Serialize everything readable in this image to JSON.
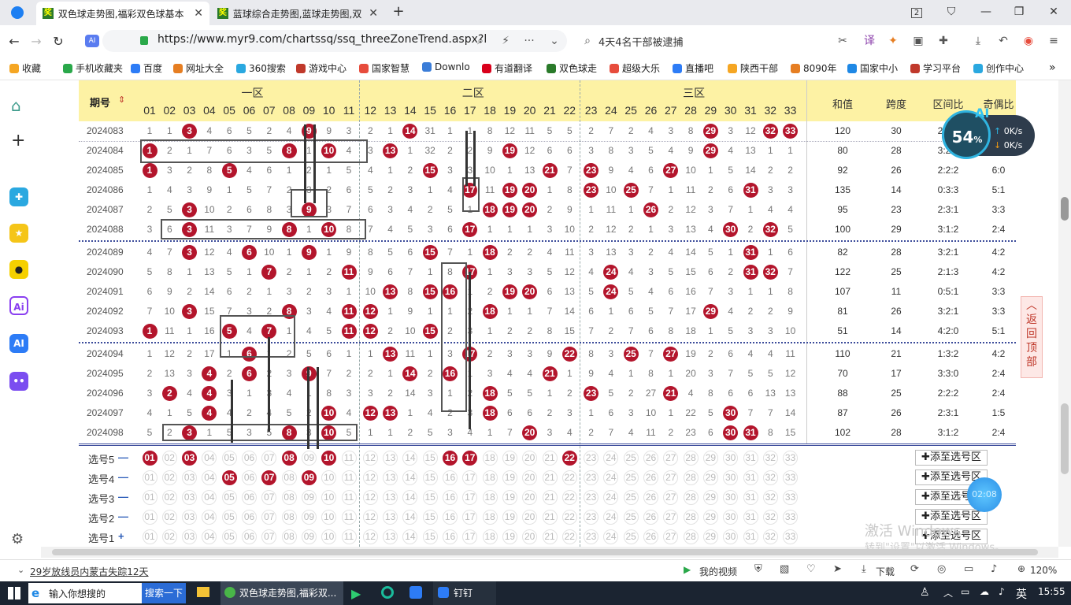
{
  "browser": {
    "tabs": [
      {
        "label": "双色球走势图,福彩双色球基本",
        "active": true
      },
      {
        "label": "蓝球综合走势图,蓝球走势图,双",
        "active": false
      }
    ],
    "url": "https://www.myr9.com/chartssq/ssq_threeZoneTrend.aspx?l",
    "search": "4天4名干部被逮捕",
    "tab_count": "2",
    "bookmarks": [
      "收藏",
      "手机收藏夹",
      "百度",
      "网址大全",
      "360搜索",
      "游戏中心",
      "国家智慧",
      "Downlo",
      "有道翻译",
      "双色球走",
      "超级大乐",
      "直播吧",
      "陕西干部",
      "8090年",
      "国家中小",
      "学习平台",
      "创作中心"
    ]
  },
  "chart": {
    "header": {
      "period": "期号",
      "zones": [
        "一区",
        "二区",
        "三区"
      ],
      "stats": [
        "和值",
        "跨度",
        "区间比",
        "奇偶比"
      ]
    },
    "numbers": [
      "01",
      "02",
      "03",
      "04",
      "05",
      "06",
      "07",
      "08",
      "09",
      "10",
      "11",
      "12",
      "13",
      "14",
      "15",
      "16",
      "17",
      "18",
      "19",
      "20",
      "21",
      "22",
      "23",
      "24",
      "25",
      "26",
      "27",
      "28",
      "29",
      "30",
      "31",
      "32",
      "33"
    ],
    "rows": [
      {
        "issue": "2024083",
        "vals": [
          1,
          1,
          3,
          4,
          6,
          5,
          2,
          4,
          9,
          9,
          3,
          2,
          1,
          14,
          31,
          1,
          1,
          8,
          12,
          11,
          5,
          5,
          2,
          7,
          2,
          4,
          3,
          8,
          29,
          3,
          12,
          32,
          33
        ],
        "hits": [
          3,
          9,
          14,
          29,
          32,
          33
        ],
        "sum": "120",
        "span": "30",
        "zone": "2:1:3",
        "oe": "3:3"
      },
      {
        "issue": "2024084",
        "vals": [
          1,
          2,
          1,
          7,
          6,
          3,
          5,
          8,
          1,
          10,
          4,
          3,
          13,
          1,
          32,
          2,
          2,
          9,
          19,
          12,
          6,
          6,
          3,
          8,
          3,
          5,
          4,
          9,
          29,
          4,
          13,
          1,
          1
        ],
        "hits": [
          1,
          8,
          10,
          13,
          19,
          29
        ],
        "sum": "80",
        "span": "28",
        "zone": "3:2:1",
        "oe": "4:2"
      },
      {
        "issue": "2024085",
        "vals": [
          1,
          3,
          2,
          8,
          5,
          4,
          6,
          1,
          2,
          1,
          5,
          4,
          1,
          2,
          15,
          3,
          3,
          10,
          1,
          13,
          21,
          7,
          23,
          9,
          4,
          6,
          27,
          10,
          1,
          5,
          14,
          2,
          2
        ],
        "hits": [
          1,
          5,
          15,
          21,
          23,
          27
        ],
        "sum": "92",
        "span": "26",
        "zone": "2:2:2",
        "oe": "6:0"
      },
      {
        "issue": "2024086",
        "vals": [
          1,
          4,
          3,
          9,
          1,
          5,
          7,
          2,
          3,
          2,
          6,
          5,
          2,
          3,
          1,
          4,
          17,
          11,
          19,
          20,
          1,
          8,
          23,
          10,
          25,
          7,
          1,
          11,
          2,
          6,
          31,
          3,
          3
        ],
        "hits": [
          17,
          19,
          20,
          23,
          25,
          31
        ],
        "sum": "135",
        "span": "14",
        "zone": "0:3:3",
        "oe": "5:1"
      },
      {
        "issue": "2024087",
        "vals": [
          2,
          5,
          3,
          10,
          2,
          6,
          8,
          3,
          9,
          3,
          7,
          6,
          3,
          4,
          2,
          5,
          1,
          18,
          19,
          20,
          2,
          9,
          1,
          11,
          1,
          26,
          2,
          12,
          3,
          7,
          1,
          4,
          4
        ],
        "hits": [
          3,
          9,
          18,
          19,
          20,
          26
        ],
        "sum": "95",
        "span": "23",
        "zone": "2:3:1",
        "oe": "3:3"
      },
      {
        "issue": "2024088",
        "vals": [
          3,
          6,
          3,
          11,
          3,
          7,
          9,
          8,
          1,
          10,
          8,
          7,
          4,
          5,
          3,
          6,
          17,
          1,
          1,
          1,
          3,
          10,
          2,
          12,
          2,
          1,
          3,
          13,
          4,
          30,
          2,
          32,
          5
        ],
        "hits": [
          3,
          8,
          10,
          17,
          30,
          32
        ],
        "sum": "100",
        "span": "29",
        "zone": "3:1:2",
        "oe": "2:4"
      },
      {
        "issue": "2024089",
        "vals": [
          4,
          7,
          3,
          12,
          4,
          6,
          10,
          1,
          9,
          1,
          9,
          8,
          5,
          6,
          15,
          7,
          1,
          18,
          2,
          2,
          4,
          11,
          3,
          13,
          3,
          2,
          4,
          14,
          5,
          1,
          31,
          1,
          6
        ],
        "hits": [
          3,
          6,
          9,
          15,
          18,
          31
        ],
        "sum": "82",
        "span": "28",
        "zone": "3:2:1",
        "oe": "4:2"
      },
      {
        "issue": "2024090",
        "vals": [
          5,
          8,
          1,
          13,
          5,
          1,
          7,
          2,
          1,
          2,
          11,
          9,
          6,
          7,
          1,
          8,
          17,
          1,
          3,
          3,
          5,
          12,
          4,
          24,
          4,
          3,
          5,
          15,
          6,
          2,
          31,
          32,
          7
        ],
        "hits": [
          7,
          11,
          17,
          24,
          31,
          32
        ],
        "sum": "122",
        "span": "25",
        "zone": "2:1:3",
        "oe": "4:2"
      },
      {
        "issue": "2024091",
        "vals": [
          6,
          9,
          2,
          14,
          6,
          2,
          1,
          3,
          2,
          3,
          1,
          10,
          13,
          8,
          15,
          16,
          1,
          2,
          19,
          20,
          6,
          13,
          5,
          24,
          5,
          4,
          6,
          16,
          7,
          3,
          1,
          1,
          8
        ],
        "hits": [
          13,
          15,
          16,
          19,
          20,
          24
        ],
        "sum": "107",
        "span": "11",
        "zone": "0:5:1",
        "oe": "3:3"
      },
      {
        "issue": "2024092",
        "vals": [
          7,
          10,
          3,
          15,
          7,
          3,
          2,
          8,
          3,
          4,
          11,
          12,
          1,
          9,
          1,
          1,
          2,
          18,
          1,
          1,
          7,
          14,
          6,
          1,
          6,
          5,
          7,
          17,
          29,
          4,
          2,
          2,
          9
        ],
        "hits": [
          3,
          8,
          11,
          12,
          18,
          29
        ],
        "sum": "81",
        "span": "26",
        "zone": "3:2:1",
        "oe": "3:3"
      },
      {
        "issue": "2024093",
        "vals": [
          1,
          11,
          1,
          16,
          5,
          4,
          7,
          1,
          4,
          5,
          11,
          12,
          2,
          10,
          15,
          2,
          3,
          1,
          2,
          2,
          8,
          15,
          7,
          2,
          7,
          6,
          8,
          18,
          1,
          5,
          3,
          3,
          10
        ],
        "hits": [
          1,
          5,
          7,
          11,
          12,
          15
        ],
        "sum": "51",
        "span": "14",
        "zone": "4:2:0",
        "oe": "5:1"
      },
      {
        "issue": "2024094",
        "vals": [
          1,
          12,
          2,
          17,
          1,
          6,
          1,
          2,
          5,
          6,
          1,
          1,
          13,
          11,
          1,
          3,
          17,
          2,
          3,
          3,
          9,
          22,
          8,
          3,
          25,
          7,
          27,
          19,
          2,
          6,
          4,
          4,
          11
        ],
        "hits": [
          6,
          13,
          17,
          22,
          25,
          27
        ],
        "sum": "110",
        "span": "21",
        "zone": "1:3:2",
        "oe": "4:2"
      },
      {
        "issue": "2024095",
        "vals": [
          2,
          13,
          3,
          4,
          2,
          6,
          2,
          3,
          9,
          7,
          2,
          2,
          1,
          14,
          2,
          16,
          1,
          3,
          4,
          4,
          21,
          1,
          9,
          4,
          1,
          8,
          1,
          20,
          3,
          7,
          5,
          5,
          12
        ],
        "hits": [
          4,
          6,
          9,
          14,
          16,
          21
        ],
        "sum": "70",
        "span": "17",
        "zone": "3:3:0",
        "oe": "2:4"
      },
      {
        "issue": "2024096",
        "vals": [
          3,
          2,
          4,
          4,
          3,
          1,
          3,
          4,
          1,
          8,
          3,
          3,
          2,
          14,
          3,
          1,
          2,
          18,
          5,
          5,
          1,
          2,
          23,
          5,
          2,
          27,
          21,
          4,
          8,
          6,
          6,
          13,
          13
        ],
        "hits": [
          2,
          4,
          18,
          23,
          27
        ],
        "sum": "88",
        "span": "25",
        "zone": "2:2:2",
        "oe": "2:4"
      },
      {
        "issue": "2024097",
        "vals": [
          4,
          1,
          5,
          4,
          4,
          2,
          4,
          5,
          2,
          10,
          4,
          12,
          13,
          1,
          4,
          2,
          3,
          18,
          6,
          6,
          2,
          3,
          1,
          6,
          3,
          10,
          1,
          22,
          5,
          30,
          7,
          7,
          14
        ],
        "hits": [
          4,
          10,
          12,
          13,
          18,
          30
        ],
        "sum": "87",
        "span": "26",
        "zone": "2:3:1",
        "oe": "1:5"
      },
      {
        "issue": "2024098",
        "vals": [
          5,
          2,
          3,
          1,
          5,
          3,
          5,
          8,
          3,
          10,
          5,
          1,
          1,
          2,
          5,
          3,
          4,
          1,
          7,
          20,
          3,
          4,
          2,
          7,
          4,
          11,
          2,
          23,
          6,
          30,
          31,
          8,
          15
        ],
        "hits": [
          3,
          8,
          10,
          20,
          30,
          31
        ],
        "sum": "102",
        "span": "28",
        "zone": "3:1:2",
        "oe": "2:4"
      }
    ],
    "picks": [
      {
        "label": "选号5",
        "sign": "—",
        "on": [
          1,
          3,
          8,
          10,
          16,
          17,
          22
        ]
      },
      {
        "label": "选号4",
        "sign": "—",
        "on": [
          5,
          7,
          9
        ]
      },
      {
        "label": "选号3",
        "sign": "—",
        "on": []
      },
      {
        "label": "选号2",
        "sign": "—",
        "on": []
      },
      {
        "label": "选号1",
        "sign": "+",
        "on": []
      }
    ],
    "add_label": "添至选号区"
  },
  "overlay": {
    "speed_pct": "54",
    "speed_unit": "%",
    "up": "0K/s",
    "down": "0K/s",
    "ai": "AI",
    "back_top": "返回顶部",
    "timer": "02:08",
    "watermark1": "激活 Windows",
    "watermark2": "转到\"设置\"以激活 Windows。"
  },
  "status": {
    "news": "29岁放线员内蒙古失踪12天",
    "video": "我的视频",
    "download": "下载",
    "zoom": "120%"
  },
  "taskbar": {
    "search": "输入你想搜的",
    "search_btn": "搜索一下",
    "app1": "双色球走势图,福彩双...",
    "app2": "钉钉",
    "ime": "英",
    "time": "15:55"
  }
}
